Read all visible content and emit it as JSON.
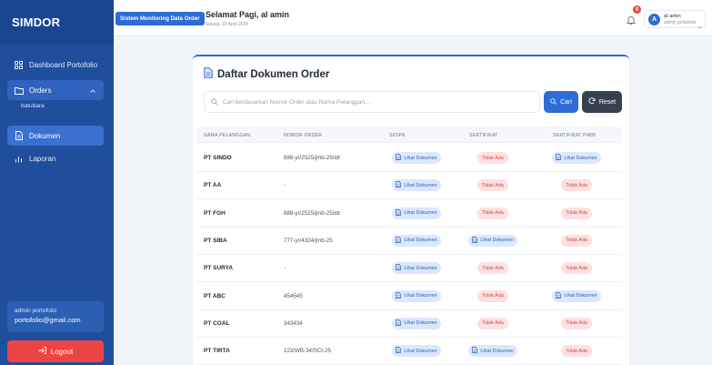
{
  "sidebar": {
    "brand": "SIMDOR",
    "items": [
      {
        "label": "Dashboard Portofolio"
      },
      {
        "label": "Orders"
      },
      {
        "label": "Dokumen"
      },
      {
        "label": "Laporan"
      }
    ],
    "sub_item": "batubara",
    "user_name": "admin portofolio",
    "user_email": "portofolio@gmail.com",
    "logout_label": "Logout"
  },
  "header": {
    "app_badge": "Sistem Monitoring Data Order",
    "greeting": "Selamat Pagi, al amin",
    "date": "Selasa, 22 April 2025",
    "notification_count": "0",
    "user": {
      "avatar_letter": "A",
      "name": "al amin",
      "role": "admin portofolio"
    }
  },
  "card": {
    "title": "Daftar Dokumen Order",
    "search_placeholder": "Cari berdasarkan Nomor Order atau Nama Pelanggan...",
    "cari_label": "Cari",
    "reset_label": "Reset",
    "columns": [
      "NAMA PELANGGAN",
      "NOMOR ORDER",
      "SI/SPK",
      "SERTIFIKAT",
      "SERTIFIKAT PM06"
    ],
    "rows": [
      {
        "nama": "PT SINDO",
        "nomor": "888-yr/2525/jmb-25/idr",
        "si_spk": "Lihat Dokumen",
        "sertifikat": "Tidak Ada",
        "pm06": "Lihat Dokumen"
      },
      {
        "nama": "PT AA",
        "nomor": "-",
        "si_spk": "Lihat Dokumen",
        "sertifikat": "Tidak Ada",
        "pm06": "Tidak Ada"
      },
      {
        "nama": "PT FGH",
        "nomor": "888-yr/2525/jmb-25/idr",
        "si_spk": "Lihat Dokumen",
        "sertifikat": "Tidak Ada",
        "pm06": "Tidak Ada"
      },
      {
        "nama": "PT SIBA",
        "nomor": "777-yr/4324/jmb-25",
        "si_spk": "Lihat Dokumen",
        "sertifikat": "Lihat Dokumen",
        "pm06": "Tidak Ada"
      },
      {
        "nama": "PT SURYA",
        "nomor": "-",
        "si_spk": "Lihat Dokumen",
        "sertifikat": "Tidak Ada",
        "pm06": "Tidak Ada"
      },
      {
        "nama": "PT ABC",
        "nomor": "454545",
        "si_spk": "Lihat Dokumen",
        "sertifikat": "Tidak Ada",
        "pm06": "Lihat Dokumen"
      },
      {
        "nama": "PT COAL",
        "nomor": "343434",
        "si_spk": "Lihat Dokumen",
        "sertifikat": "Tidak Ada",
        "pm06": "Tidak Ada"
      },
      {
        "nama": "PT TIRTA",
        "nomor": "123/WB-34/SCI-25",
        "si_spk": "Lihat Dokumen",
        "sertifikat": "Lihat Dokumen",
        "pm06": "Tidak Ada"
      }
    ]
  },
  "colors": {
    "sidebar_bg": "#1e4e9c",
    "active_item": "#3a70d0",
    "primary": "#2d6cd6",
    "danger": "#ef4444",
    "reset_button": "#374151"
  }
}
